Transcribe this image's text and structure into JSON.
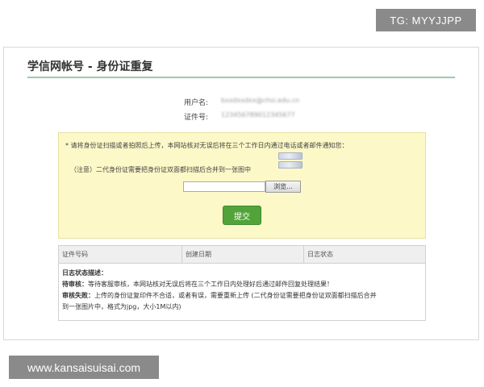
{
  "watermarks": {
    "tg": "TG: MYYJJPP",
    "site": "www.kansaisuisai.com"
  },
  "page": {
    "title": "学信网帐号 - 身份证重复"
  },
  "account": {
    "username_label": "用户名:",
    "username_value": "bxxdxxdxx@chsi.edu.cn",
    "id_label": "证件号:",
    "id_value": "123456789012345677"
  },
  "notice": {
    "line1": "* 请将身份证扫描或者拍照后上传，本网站核对无误后将在三个工作日内通过电话或者邮件通知您：",
    "line2": "（注意）二代身份证需要把身份证双面都扫描后合并到一张图中",
    "browse_label": "浏览...",
    "submit_label": "提交"
  },
  "log_table": {
    "columns": [
      "证件号码",
      "创建日期",
      "日志状态"
    ],
    "desc_title": "日志状态描述：",
    "pending_label": "待审核：",
    "pending_text": "等待客服审核，本网站核对无误后将在三个工作日内处理好后通过邮件回复处理结果！",
    "failed_label": "审核失败：",
    "failed_text_1": "上传的身份证复印件不合适，或者有误，需要重新上传 (二代身份证需要把身份证双面都扫描后合并",
    "failed_text_2": "到一张图片中，格式为jpg，大小1M以内)"
  },
  "icons": {
    "id_thumbnail": "id-card-sample-icon"
  },
  "colors": {
    "accent_green": "#52a43a",
    "notice_bg": "#fdf8c7",
    "title_rule": "#9bc9a9"
  }
}
